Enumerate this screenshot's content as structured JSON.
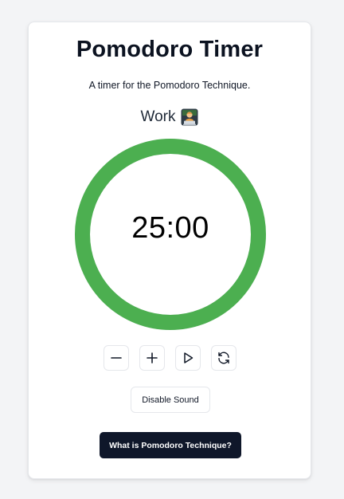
{
  "header": {
    "title": "Pomodoro Timer",
    "subtitle": "A timer for the Pomodoro Technique."
  },
  "session": {
    "mode_label": "Work",
    "mode_icon": "person-at-laptop-icon"
  },
  "timer": {
    "display": "25:00",
    "progress": 1.0,
    "ring_color": "#4caf50"
  },
  "controls": {
    "decrease_icon": "minus-icon",
    "increase_icon": "plus-icon",
    "start_icon": "play-icon",
    "reset_icon": "refresh-icon"
  },
  "sound_button": {
    "label": "Disable Sound"
  },
  "info_button": {
    "label": "What is Pomodoro Technique?"
  },
  "colors": {
    "page_background": "#f3f4f6",
    "card_background": "#ffffff",
    "primary_dark": "#0f172a",
    "accent_green": "#4caf50"
  }
}
